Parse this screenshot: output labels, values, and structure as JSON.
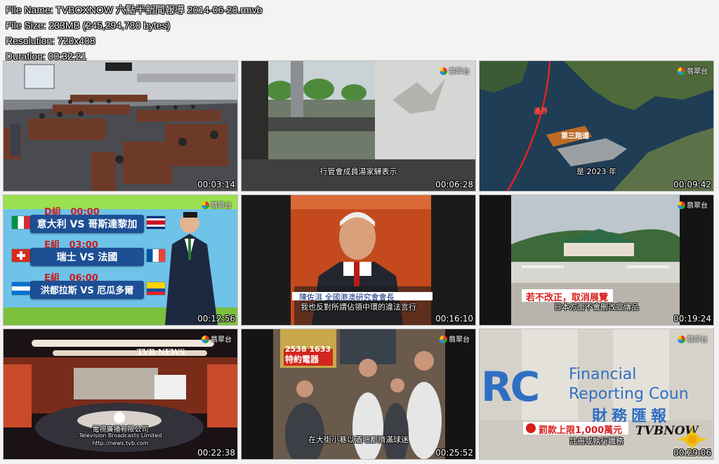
{
  "meta": {
    "file_name": "File Name: TVBOXNOW 六點半新聞報導 2014-06-20.rmvb",
    "file_size": "File Size: 233MB (245,294,780 bytes)",
    "resolution": "Resolution: 720x408",
    "duration": "Duration: 00:32:21"
  },
  "channel_logo": "翡翠台",
  "thumbnails": [
    {
      "timestamp": "00:03:14"
    },
    {
      "timestamp": "00:06:28",
      "subtitle": "行管會成員湯家驊表示"
    },
    {
      "timestamp": "00:09:42",
      "map_label_1": "第三跑道",
      "map_label_2": "邊界",
      "subtitle": "是 2023 年"
    },
    {
      "timestamp": "00:12:56",
      "matches": [
        {
          "group": "D組",
          "time": "00:00",
          "teams": "意大利 VS 哥斯達黎加"
        },
        {
          "group": "E組",
          "time": "03:00",
          "teams": "瑞士 VS 法國"
        },
        {
          "group": "E組",
          "time": "06:00",
          "teams": "洪都拉斯 VS 厄瓜多爾"
        }
      ]
    },
    {
      "timestamp": "00:16:10",
      "caption_name": "陳佐洱 全國港澳研究會會長",
      "subtitle": "我也反對所謂佔領中環的違法言行"
    },
    {
      "timestamp": "00:19:24",
      "caption_title": "若不改正，取消展覽",
      "subtitle": "日本方面不會刪改宣傳品"
    },
    {
      "timestamp": "00:22:38",
      "sign": "TVB NEWS",
      "building_name": "電視廣播有限公司",
      "building_sub": "Television Broadcasts Limited",
      "url": "http://news.tvb.com"
    },
    {
      "timestamp": "00:25:52",
      "shop_phone": "2538 1633",
      "shop_sign": "特約電器",
      "subtitle": "在大街小巷以酒吧都擠滿球迷"
    },
    {
      "timestamp": "00:29:06",
      "logo_text": "RC",
      "org_en_1": "Financial",
      "org_en_2": "Reporting Coun",
      "org_zh": "財務匯報",
      "caption_title": "罰款上限1,000萬元",
      "subtitle": "註冊或執行職務",
      "watermark": "TVBNOW"
    }
  ]
}
